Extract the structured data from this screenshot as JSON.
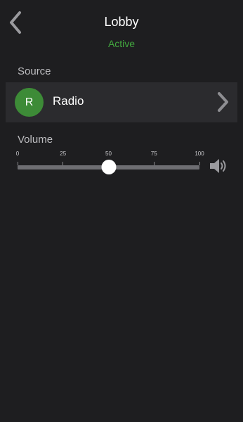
{
  "header": {
    "title": "Lobby",
    "status": "Active",
    "back_icon": "chevron-left-icon"
  },
  "source": {
    "section_label": "Source",
    "avatar_letter": "R",
    "name": "Radio",
    "chevron_icon": "chevron-right-icon"
  },
  "volume": {
    "section_label": "Volume",
    "tick_labels": [
      "0",
      "25",
      "50",
      "75",
      "100"
    ],
    "min": 0,
    "max": 100,
    "value": 50,
    "speaker_icon": "speaker-icon"
  },
  "colors": {
    "background": "#1e1e20",
    "row_background": "#2b2b2e",
    "accent_green": "#43a83f",
    "avatar_green": "#3d8b37",
    "label_gray": "#bdbdc0",
    "track_gray": "#6e6e72"
  }
}
